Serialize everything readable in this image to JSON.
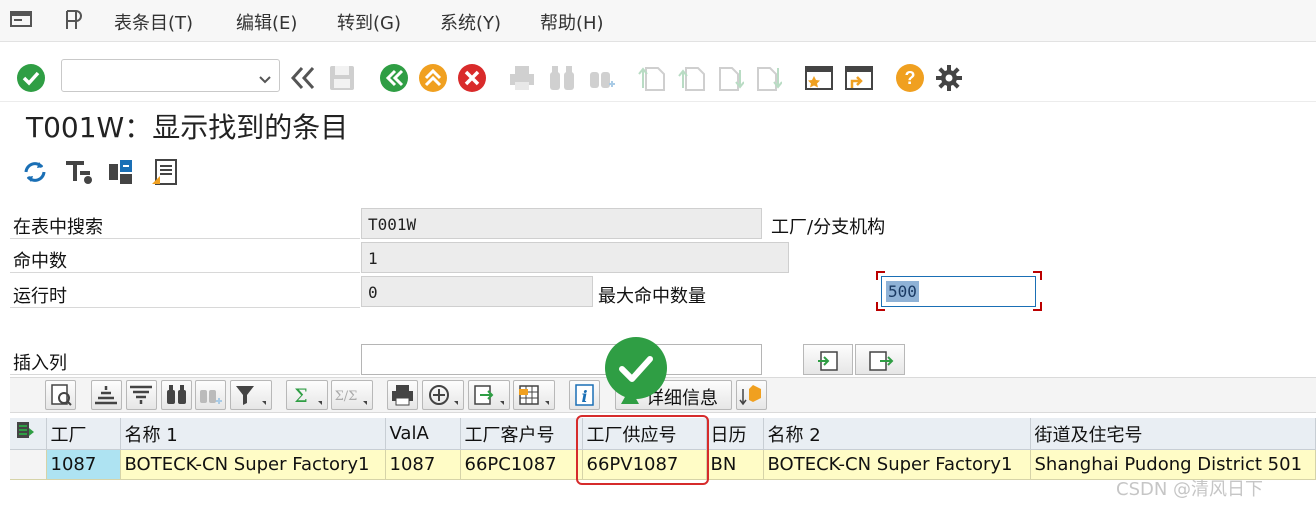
{
  "menu": {
    "items": [
      "表条目(T)",
      "编辑(E)",
      "转到(G)",
      "系统(Y)",
      "帮助(H)"
    ]
  },
  "toolbar": {
    "command_value": "",
    "icons": [
      "enter-icon",
      "command-dropdown-icon",
      "back-double-arrow-icon",
      "save-icon",
      "back-icon",
      "exit-icon",
      "cancel-icon",
      "print-icon",
      "find-icon",
      "find-next-icon",
      "first-page-icon",
      "prev-page-icon",
      "next-page-icon",
      "last-page-icon",
      "create-session-icon",
      "shortcut-icon",
      "help-icon",
      "settings-icon"
    ]
  },
  "page_title": "T001W：显示找到的条目",
  "form": {
    "search_table_label": "在表中搜索",
    "search_table_value": "T001W",
    "search_table_desc": "工厂/分支机构",
    "hits_label": "命中数",
    "hits_value": "1",
    "runtime_label": "运行时",
    "runtime_value": "0",
    "max_hits_label": "最大命中数量",
    "max_hits_value": "500",
    "insert_col_label": "插入列",
    "insert_col_value": ""
  },
  "alv": {
    "detail_label": "详细信息"
  },
  "table": {
    "columns": [
      "工厂",
      "名称 1",
      "ValA",
      "工厂客户号",
      "工厂供应号",
      "日历",
      "名称 2",
      "街道及住宅号"
    ],
    "rows": [
      [
        "1087",
        "BOTECK-CN Super Factory1",
        "1087",
        "66PC1087",
        "66PV1087",
        "BN",
        "BOTECK-CN Super Factory1",
        "Shanghai Pudong District 501"
      ]
    ]
  },
  "watermark": "CSDN @清风日下",
  "colors": {
    "green": "#2f9e44",
    "yellow": "#f0a020",
    "red": "#d92b2b",
    "highlight": "#d62b2b",
    "row_bg": "#fffcc6",
    "key_bg": "#aee3f2",
    "header_bg": "#e9eef3"
  }
}
